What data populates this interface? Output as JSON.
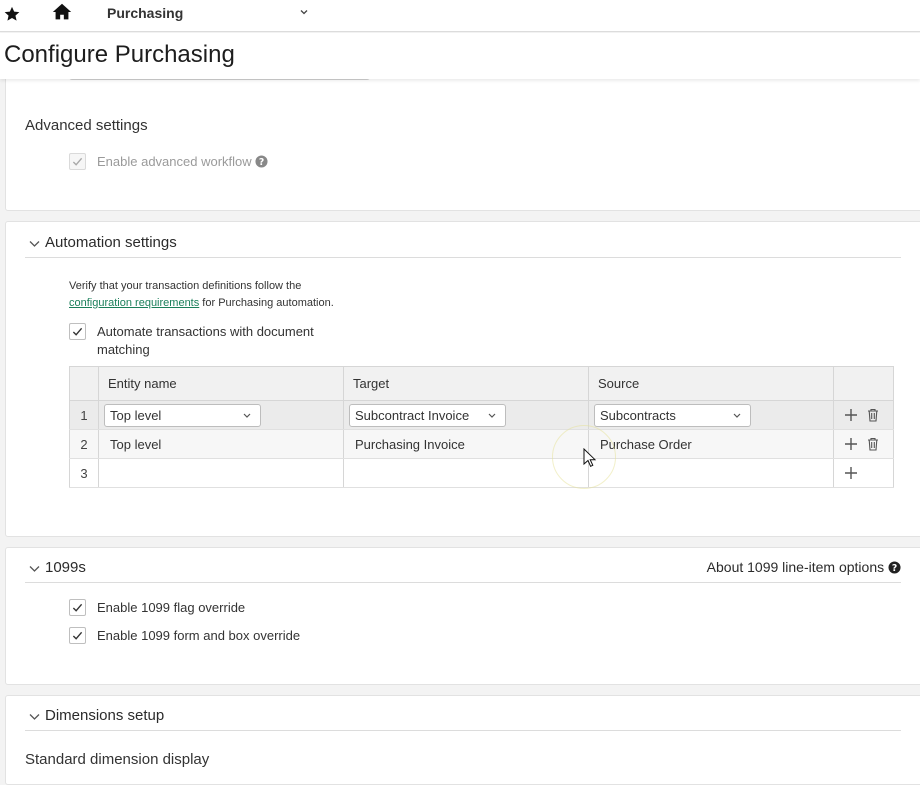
{
  "topbar": {
    "app_title": "Purchasing"
  },
  "page": {
    "title": "Configure Purchasing"
  },
  "advanced": {
    "title": "Advanced settings",
    "workflow_label": "Enable advanced workflow"
  },
  "automation": {
    "title": "Automation settings",
    "intro_before": "Verify that your transaction definitions follow the",
    "link": "configuration requirements",
    "intro_after": " for Purchasing automation.",
    "automate_label": "Automate transactions with document matching",
    "columns": [
      "Entity name",
      "Target",
      "Source"
    ],
    "rows": [
      {
        "num": "1",
        "entity": "Top level",
        "target": "Subcontract Invoice",
        "source": "Subcontracts"
      },
      {
        "num": "2",
        "entity": "Top level",
        "target": "Purchasing Invoice",
        "source": "Purchase Order"
      },
      {
        "num": "3",
        "entity": "",
        "target": "",
        "source": ""
      }
    ]
  },
  "s1099": {
    "title": "1099s",
    "about_link": "About 1099 line-item options",
    "flag_label": "Enable 1099 flag override",
    "form_label": "Enable 1099 form and box override"
  },
  "dimensions": {
    "title": "Dimensions setup",
    "standard_display": "Standard dimension display"
  },
  "colors": {
    "link": "#1a7f5a",
    "header_bg": "#f1f1f1"
  },
  "icons": [
    "star-icon",
    "home-icon",
    "chevron-down-icon",
    "help-icon",
    "check-icon",
    "plus-icon",
    "trash-icon"
  ]
}
